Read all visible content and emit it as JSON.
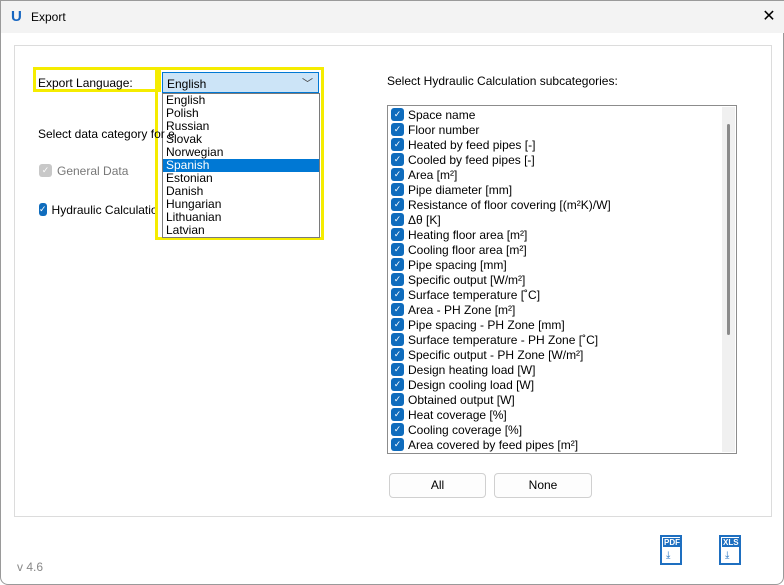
{
  "window": {
    "title": "Export",
    "logo": "U",
    "close": "✕"
  },
  "language": {
    "label": "Export Language:",
    "selected": "English",
    "options": [
      "English",
      "Polish",
      "Russian",
      "Slovak",
      "Norwegian",
      "Spanish",
      "Estonian",
      "Danish",
      "Hungarian",
      "Lithuanian",
      "Latvian"
    ],
    "highlighted": "Spanish"
  },
  "category": {
    "label": "Select data category for e",
    "general": "General Data",
    "hydraulic": "Hydraulic Calculation"
  },
  "sub": {
    "label": "Select Hydraulic Calculation subcategories:",
    "items": [
      "Space name",
      "Floor number",
      "Heated by feed pipes [-]",
      "Cooled by feed pipes [-]",
      "Area [m²]",
      "Pipe diameter [mm]",
      "Resistance of floor covering [(m²K)/W]",
      "Δθ [K]",
      "Heating floor area [m²]",
      "Cooling floor area [m²]",
      "Pipe spacing [mm]",
      "Specific output [W/m²]",
      "Surface temperature [˚C]",
      "Area - PH Zone [m²]",
      "Pipe spacing - PH Zone [mm]",
      "Surface temperature - PH Zone [˚C]",
      "Specific output - PH Zone [W/m²]",
      "Design heating load [W]",
      "Design cooling load [W]",
      "Obtained output [W]",
      "Heat coverage [%]",
      "Cooling coverage [%]",
      "Area covered by feed pipes [m²]"
    ]
  },
  "buttons": {
    "all": "All",
    "none": "None",
    "pdf": "PDF",
    "xls": "XLS"
  },
  "version": "v 4.6",
  "colors": {
    "accent": "#0f6cbd",
    "highlight": "#f5ec00"
  }
}
